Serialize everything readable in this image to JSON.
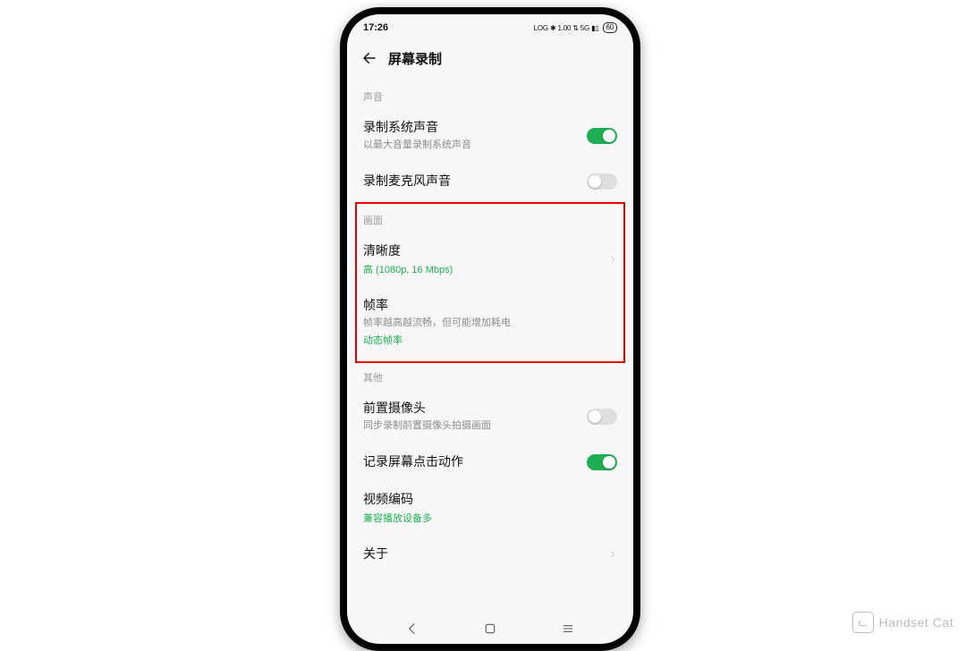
{
  "status": {
    "time": "17:26",
    "extra": "LOG  ✱ 1.00  ⇅  5G  ▮▯",
    "battery": "60"
  },
  "header": {
    "title": "屏幕录制"
  },
  "sections": {
    "sound": {
      "label": "声音",
      "recSystem": {
        "title": "录制系统声音",
        "sub": "以最大音量录制系统声音",
        "on": true
      },
      "recMic": {
        "title": "录制麦克风声音",
        "on": false
      }
    },
    "picture": {
      "label": "画面",
      "resolution": {
        "title": "清晰度",
        "value": "高 (1080p, 16 Mbps)"
      },
      "fps": {
        "title": "帧率",
        "sub": "帧率越高越流畅，但可能增加耗电",
        "value": "动态帧率"
      }
    },
    "other": {
      "label": "其他",
      "frontCam": {
        "title": "前置摄像头",
        "sub": "同步录制前置摄像头拍摄画面",
        "on": false
      },
      "touches": {
        "title": "记录屏幕点击动作",
        "on": true
      },
      "codec": {
        "title": "视频编码",
        "value": "兼容播放设备多"
      },
      "about": {
        "title": "关于"
      }
    }
  },
  "watermark": "Handset Cat"
}
